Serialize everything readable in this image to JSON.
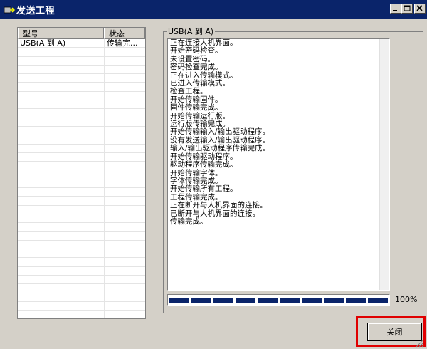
{
  "window": {
    "title": "发送工程"
  },
  "table": {
    "headers": [
      "型号",
      "状态"
    ],
    "rows": [
      [
        "USB(A 到 A)",
        "传输完..."
      ]
    ]
  },
  "group": {
    "title": "USB(A 到 A)"
  },
  "log_lines": [
    "正在连接人机界面。",
    "开始密码检查。",
    "未设置密码。",
    "密码检查完成。",
    "正在进入传输模式。",
    "已进入传输模式。",
    "检查工程。",
    "开始传输固件。",
    "固件传输完成。",
    "开始传输运行版。",
    "运行版传输完成。",
    "开始传输输入/输出驱动程序。",
    "没有发送输入/输出驱动程序。",
    "输入/输出驱动程序传输完成。",
    "开始传输驱动程序。",
    "驱动程序传输完成。",
    "开始传输字体。",
    "字体传输完成。",
    "开始传输所有工程。",
    "工程传输完成。",
    "正在断开与人机界面的连接。",
    "已断开与人机界面的连接。",
    "传输完成。"
  ],
  "progress": {
    "value": 1.0,
    "label": "100%"
  },
  "buttons": {
    "close_label": "关闭"
  },
  "colors": {
    "title_bar": "#0a246a",
    "progress_fill": "#0a246a",
    "highlight": "#e00000",
    "face": "#d4d0c8"
  }
}
